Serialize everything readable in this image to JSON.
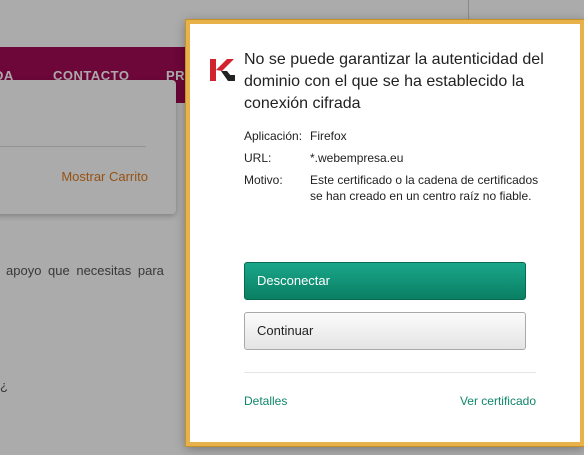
{
  "background_page": {
    "nav_items": [
      "DA",
      "CONTACTO",
      "PR"
    ],
    "cart_link": "Mostrar Carrito",
    "body_text": "apoyo que necesitas para",
    "stray_symbol": "¿"
  },
  "dialog": {
    "title": "No se puede garantizar la autenticidad del dominio con el que se ha establecido la conexión cifrada",
    "logo_icon": "kaspersky-k-icon",
    "fields": {
      "app_label": "Aplicación:",
      "app_value": "Firefox",
      "url_label": "URL:",
      "url_value": "*.webempresa.eu",
      "reason_label": "Motivo:",
      "reason_value": "Este certificado o la cadena de certificados se han creado en un centro raíz no fiable."
    },
    "disconnect_label": "Desconectar",
    "continue_label": "Continuar",
    "details_link": "Detalles",
    "view_cert_link": "Ver certificado",
    "colors": {
      "accent": "#0f8b6e",
      "frame": "#e8b24a",
      "brand_red": "#d2222d"
    }
  }
}
